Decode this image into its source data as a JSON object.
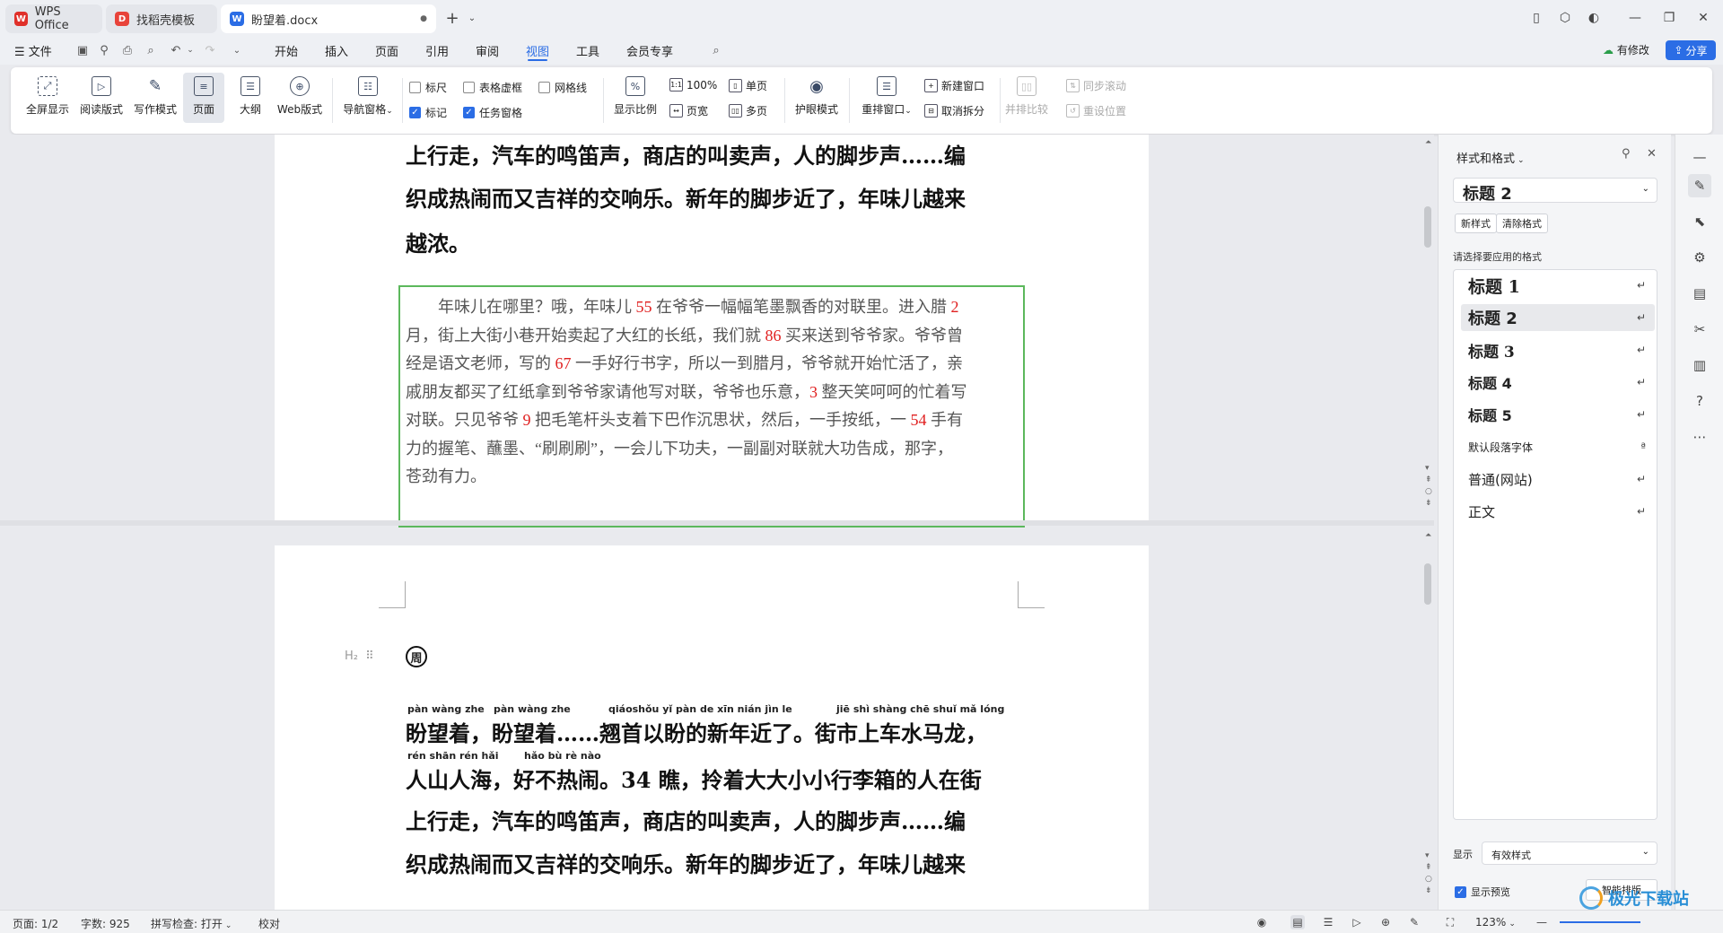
{
  "tabs": [
    {
      "label": "WPS Office",
      "icon": "wps-logo"
    },
    {
      "label": "找稻壳模板",
      "icon": "docer-logo"
    },
    {
      "label": "盼望着.docx",
      "icon": "word-doc-logo"
    }
  ],
  "menu": {
    "file_label": "文件",
    "items": [
      "开始",
      "插入",
      "页面",
      "引用",
      "审阅",
      "视图",
      "工具",
      "会员专享"
    ],
    "active": "视图",
    "has_changes_label": "有修改",
    "share_label": "分享"
  },
  "ribbon": {
    "view_buttons": [
      "全屏显示",
      "阅读版式",
      "写作模式",
      "页面",
      "大纲",
      "Web版式"
    ],
    "active_view": "页面",
    "nav_pane_label": "导航窗格",
    "checkboxes": [
      {
        "label": "标尺",
        "checked": false
      },
      {
        "label": "表格虚框",
        "checked": false
      },
      {
        "label": "网格线",
        "checked": false
      },
      {
        "label": "标记",
        "checked": true
      },
      {
        "label": "任务窗格",
        "checked": true
      }
    ],
    "zoom_label": "显示比例",
    "zoom_100": "100%",
    "page_width": "页宽",
    "single_page": "单页",
    "multi_page": "多页",
    "eye_protect": "护眼模式",
    "rearrange": "重排窗口",
    "new_window": "新建窗口",
    "cancel_split": "取消拆分",
    "side_by_side": "并排比较",
    "sync_scroll": "同步滚动",
    "reset_position": "重设位置"
  },
  "document": {
    "page1_lines": [
      "上行走，汽车的鸣笛声，商店的叫卖声，人的脚步声……编",
      "织成热闹而又吉祥的交响乐。新年的脚步近了，年味儿越来",
      "越浓。"
    ],
    "para_lines": [
      [
        {
          "t": "　　年味儿在哪里？哦，年味儿 "
        },
        {
          "t": "55",
          "n": true
        },
        {
          "t": " 在爷爷一幅幅笔墨飘香的对联里。进入腊 "
        },
        {
          "t": "2",
          "n": true
        }
      ],
      [
        {
          "t": "月，街上大街小巷开始卖起了大红的长纸，我们就 "
        },
        {
          "t": "86",
          "n": true
        },
        {
          "t": " 买来送到爷爷家。爷爷曾"
        }
      ],
      [
        {
          "t": "经是语文老师，写的 "
        },
        {
          "t": "67",
          "n": true
        },
        {
          "t": " 一手好行书字，所以一到腊月，爷爷就开始忙活了，亲"
        }
      ],
      [
        {
          "t": "戚朋友都买了红纸拿到爷爷家请他写对联，爷爷也乐意，"
        },
        {
          "t": "3",
          "n": true
        },
        {
          "t": " 整天笑呵呵的忙着写"
        }
      ],
      [
        {
          "t": "对联。只见爷爷 "
        },
        {
          "t": "9",
          "n": true
        },
        {
          "t": " 把毛笔杆头支着下巴作沉思状，然后，一手按纸，一 "
        },
        {
          "t": "54",
          "n": true
        },
        {
          "t": " 手有"
        }
      ],
      [
        {
          "t": "力的握笔、蘸墨、“刷刷刷”，一会儿下功夫，一副副对联就大功告成，那字，"
        }
      ],
      [
        {
          "t": "苍劲有力。"
        }
      ]
    ],
    "heading_marker": "H₂",
    "heading_char": "周",
    "page2_pinyin_1": [
      {
        "t": "pàn wàng zhe"
      },
      {
        "t": "pàn wàng zhe"
      },
      {
        "t": "qiáoshǒu yǐ   pàn   de   xīn nián jìn   le"
      },
      {
        "t": "jiē  shì shàng chē shuǐ  mǎ  lóng"
      }
    ],
    "page2_pinyin_2": [
      {
        "t": "rén shān rén  hǎi"
      },
      {
        "t": "hǎo  bù   rè   nào"
      }
    ],
    "page2_lines": [
      "盼望着，盼望着……翘首以盼的新年近了。街市上车水马龙，",
      "人山人海，好不热闹。34 瞧，拎着大大小小行李箱的人在街",
      "上行走，汽车的鸣笛声，商店的叫卖声，人的脚步声……编",
      "织成热闹而又吉祥的交响乐。新年的脚步近了，年味儿越来"
    ]
  },
  "panel": {
    "title": "样式和格式",
    "current_style": "标题 2",
    "new_style": "新样式",
    "clear_format": "清除格式",
    "prompt": "请选择要应用的格式",
    "styles": [
      {
        "label": "标题  1",
        "size": "h1"
      },
      {
        "label": "标题  2",
        "size": "h2",
        "selected": true
      },
      {
        "label": "标题  3",
        "size": "h3"
      },
      {
        "label": "标题 4",
        "size": "h4"
      },
      {
        "label": "标题  5",
        "size": "h5"
      },
      {
        "label": "默认段落字体",
        "size": "small"
      },
      {
        "label": "普通(网站)",
        "size": "normal"
      },
      {
        "label": "正文",
        "size": "normal"
      }
    ],
    "show_label": "显示",
    "show_value": "有效样式",
    "preview_label": "显示预览",
    "preview_checked": true,
    "smart_label": "智能排版"
  },
  "status": {
    "page": "页面: 1/2",
    "words": "字数: 925",
    "spell": "拼写检查: 打开",
    "proof": "校对",
    "zoom": "123%"
  },
  "watermark": "极光下载站",
  "accent": "#2b6de5"
}
